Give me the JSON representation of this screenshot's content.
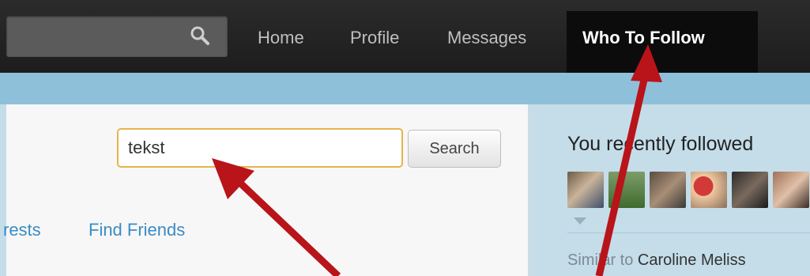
{
  "topbar": {
    "search_icon": "search-icon",
    "nav": [
      "Home",
      "Profile",
      "Messages"
    ],
    "active_nav": "Who To Follow"
  },
  "search": {
    "value": "tekst",
    "button_label": "Search"
  },
  "tabs": [
    "rests",
    "Find Friends"
  ],
  "sidebar": {
    "title": "You recently followed",
    "avatar_count": 6,
    "similar_prefix": "Similar to ",
    "similar_name": "Caroline Meliss"
  },
  "annotations": {
    "arrow_color": "#b8141a"
  },
  "colors": {
    "topbar": "#1d1d1d",
    "accent_blue": "#8fc0da",
    "link": "#3a8cc4",
    "input_focus": "#e6b34f"
  }
}
